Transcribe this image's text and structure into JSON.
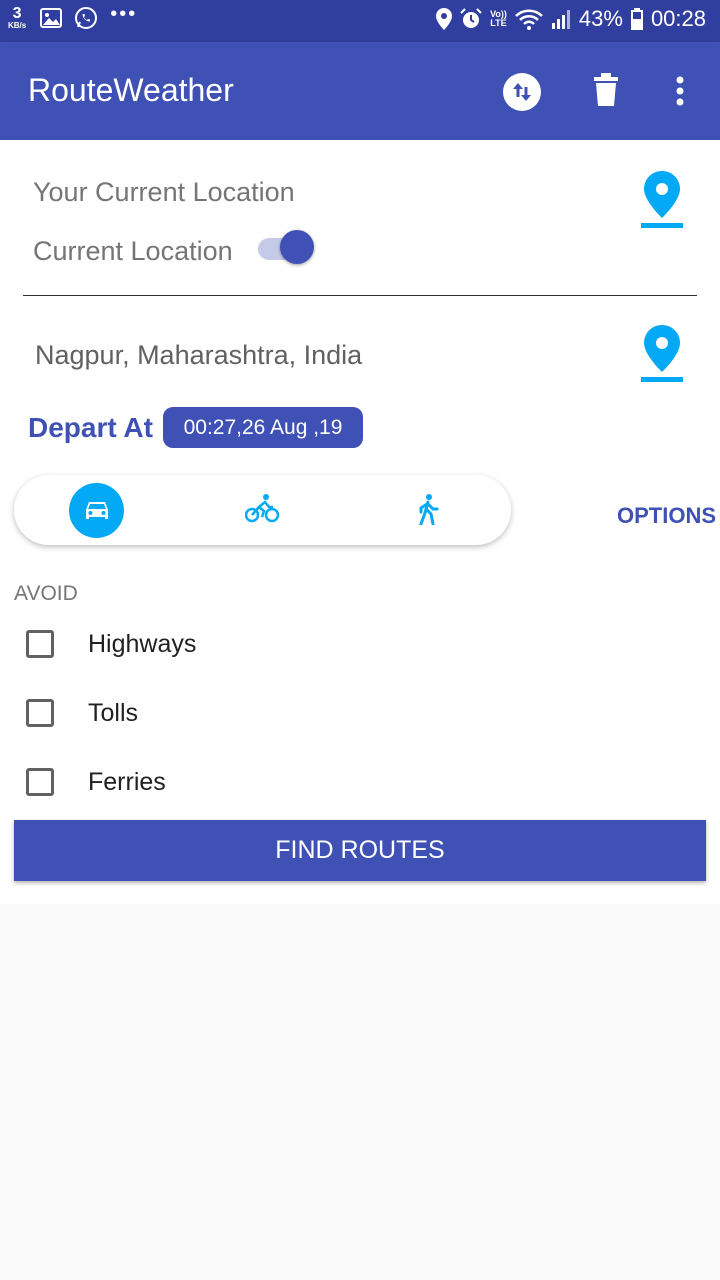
{
  "status_bar": {
    "net_speed_value": "3",
    "net_speed_unit": "KB/s",
    "overflow": "•••",
    "volte_top": "Vo))",
    "volte_bottom": "LTE",
    "battery_percent": "43%",
    "time": "00:28"
  },
  "app_bar": {
    "title": "RouteWeather"
  },
  "route": {
    "origin_text": "Your Current Location",
    "current_location_label": "Current Location",
    "current_location_enabled": true,
    "destination_text": "Nagpur, Maharashtra, India",
    "depart_label": "Depart At  :",
    "depart_value": "00:27,26 Aug ,19"
  },
  "travel_modes": {
    "selected": "car",
    "items": [
      "car-icon",
      "bike-icon",
      "walk-icon"
    ]
  },
  "options_label": "OPTIONS",
  "avoid": {
    "label": "AVOID",
    "items": [
      {
        "label": "Highways",
        "checked": false
      },
      {
        "label": "Tolls",
        "checked": false
      },
      {
        "label": "Ferries",
        "checked": false
      }
    ]
  },
  "find_routes_label": "FIND ROUTES",
  "colors": {
    "primary": "#3f51b5",
    "primary_dark": "#303f9f",
    "accent": "#03a9f4"
  }
}
